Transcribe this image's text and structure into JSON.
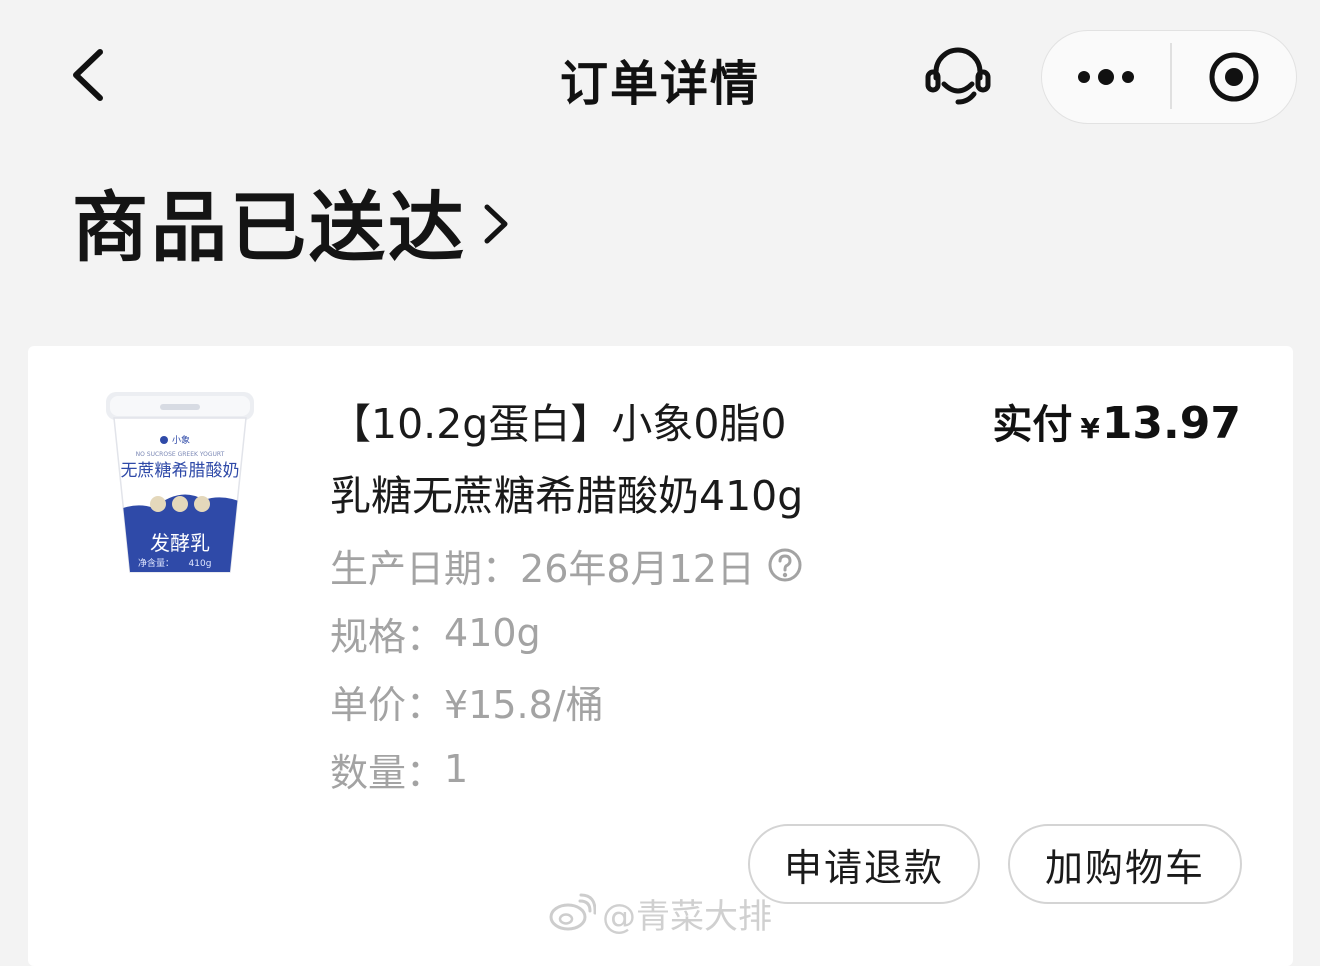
{
  "nav": {
    "title": "订单详情",
    "back_icon": "chevron-left-icon",
    "service_icon": "headset-icon",
    "more_icon": "more-dots-icon",
    "close_icon": "target-close-icon"
  },
  "status": {
    "text": "商品已送达",
    "chevron_icon": "chevron-right-icon"
  },
  "product": {
    "name_line1": "【10.2g蛋白】小象0脂0",
    "name_line2": "乳糖无蔗糖希腊酸奶410g",
    "price_label": "实付",
    "price_symbol": "¥",
    "price_value": "13.97",
    "production_date_label": "生产日期：",
    "production_date_value": "26年8月12日",
    "spec_label": "规格：",
    "spec_value": "410g",
    "unit_price_label": "单价：",
    "unit_price_value": "¥15.8/桶",
    "quantity_label": "数量：",
    "quantity_value": "1",
    "image": {
      "brand": "小象",
      "english": "NO SUCROSE GREEK YOGURT",
      "title": "无蔗糖希腊酸奶",
      "subtitle": "发酵乳",
      "net_label": "净含量：",
      "net_value": "410g"
    }
  },
  "buttons": {
    "refund": "申请退款",
    "add_to_cart": "加购物车"
  },
  "watermark": {
    "text": "@青菜大排"
  },
  "colors": {
    "background": "#f3f3f3",
    "card": "#ffffff",
    "secondary_text": "#a3a3a3",
    "yogurt_blue": "#2f4aa8"
  }
}
